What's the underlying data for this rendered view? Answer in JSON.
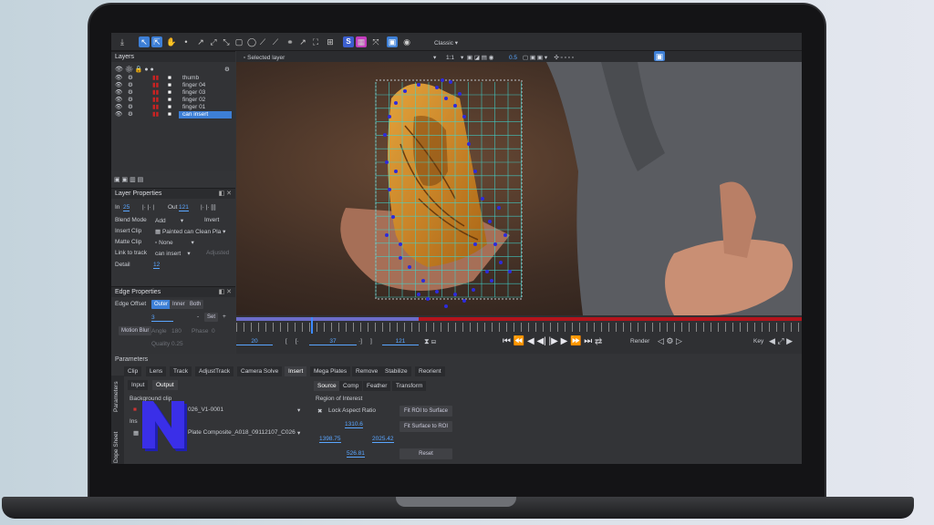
{
  "toolbar": {
    "workspace": "Classic"
  },
  "viewer": {
    "selected": "Selected layer",
    "zoom": "1:1",
    "zoom_value": "0.5"
  },
  "layers": {
    "title": "Layers",
    "items": [
      "thumb",
      "finger 04",
      "finger 03",
      "finger 02",
      "finger 01",
      "can insert"
    ],
    "selected_index": 5
  },
  "layer_props": {
    "title": "Layer Properties",
    "in_label": "In",
    "in_value": "25",
    "out_label": "Out",
    "out_value": "121",
    "blend_label": "Blend Mode",
    "blend_value": "Add",
    "invert": "Invert",
    "insert_label": "Insert Clip",
    "insert_value": "Painted can Clean Pla",
    "matte_label": "Matte Clip",
    "matte_value": "None",
    "link_label": "Link to track",
    "link_value": "can insert",
    "adjusted": "Adjusted",
    "detail_label": "Detail",
    "detail_value": "12"
  },
  "edge_props": {
    "title": "Edge Properties",
    "offset_label": "Edge Offset",
    "offset_modes": [
      "Outer",
      "Inner",
      "Both"
    ],
    "offset_value": "3",
    "set_btn": "Set",
    "motion_blur": "Motion Blur",
    "angle_label": "Angle",
    "angle_value": "180",
    "phase_label": "Phase",
    "phase_value": "0",
    "quality_label": "Quality",
    "quality_value": "0.25"
  },
  "timeline": {
    "start": "20",
    "in": "37",
    "out": "121",
    "render": "Render",
    "key": "Key"
  },
  "params": {
    "title": "Parameters",
    "tabs": [
      "Clip",
      "Lens",
      "Track",
      "AdjustTrack",
      "Camera Solve",
      "Insert",
      "Mega Plates",
      "Remove",
      "Stabilize",
      "Reorient"
    ],
    "active_tab": "Insert",
    "subtabs": [
      "Input",
      "Output"
    ],
    "side_tabs": [
      "Parameters",
      "Dope Sheet"
    ],
    "bg_clip_label": "Background clip",
    "bg_clip_value": "026_V1-0001",
    "insert_label": "Ins",
    "insert_value": "Plate Composite_A018_09112107_C026",
    "src_tabs": [
      "Source",
      "Comp",
      "Feather",
      "Transform"
    ],
    "roi_title": "Region of Interest",
    "lock_aspect": "Lock Aspect Ratio",
    "roi_top": "1310.6",
    "roi_left": "1398.75",
    "roi_right": "2025.42",
    "roi_bottom": "526.81",
    "fit_roi": "Fit ROI to Surface",
    "fit_surface": "Fit Surface to ROI",
    "reset": "Reset"
  }
}
